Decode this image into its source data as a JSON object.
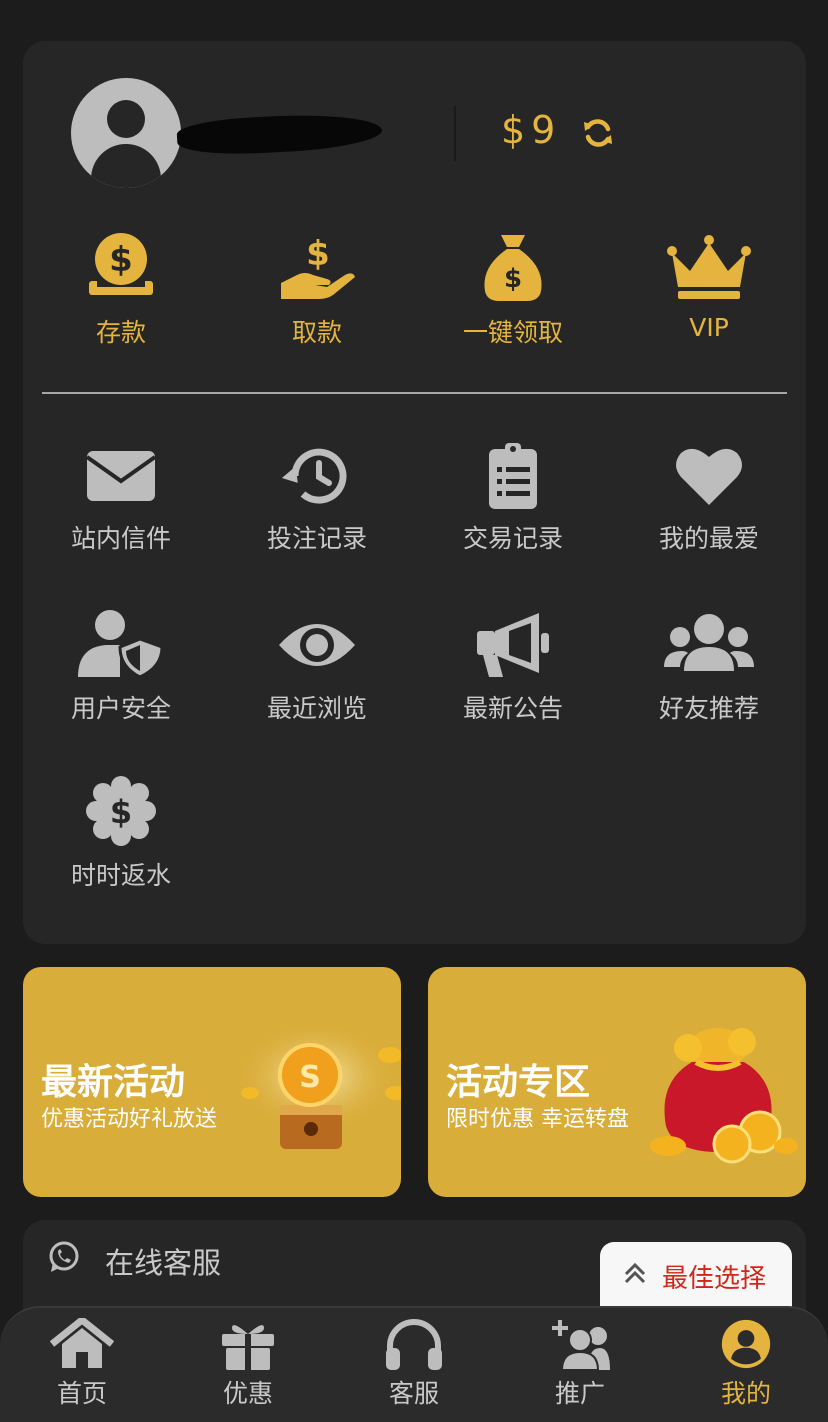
{
  "colors": {
    "accent": "#e4b43e",
    "card": "#262626",
    "background": "#1c1c1c",
    "icon_gray": "#bdbdbd",
    "best_red": "#d0261c"
  },
  "profile": {
    "balance": "$9",
    "avatar_icon": "user-avatar-icon",
    "refresh_icon": "refresh-icon"
  },
  "quick_actions": [
    {
      "label": "存款",
      "icon": "deposit-coin-icon"
    },
    {
      "label": "取款",
      "icon": "withdraw-hand-icon"
    },
    {
      "label": "一键领取",
      "icon": "money-bag-icon"
    },
    {
      "label": "VIP",
      "icon": "crown-icon"
    }
  ],
  "menu": [
    {
      "label": "站内信件",
      "icon": "mail-icon"
    },
    {
      "label": "投注记录",
      "icon": "history-icon"
    },
    {
      "label": "交易记录",
      "icon": "clipboard-icon"
    },
    {
      "label": "我的最爱",
      "icon": "heart-icon"
    },
    {
      "label": "用户安全",
      "icon": "user-shield-icon"
    },
    {
      "label": "最近浏览",
      "icon": "eye-icon"
    },
    {
      "label": "最新公告",
      "icon": "megaphone-icon"
    },
    {
      "label": "好友推荐",
      "icon": "users-icon"
    },
    {
      "label": "时时返水",
      "icon": "dollar-badge-icon"
    }
  ],
  "promos": [
    {
      "title": "最新活动",
      "subtitle": "优惠活动好礼放送"
    },
    {
      "title": "活动专区",
      "subtitle": "限时优惠 幸运转盘"
    }
  ],
  "support": {
    "label": "在线客服",
    "icon": "whatsapp-icon"
  },
  "best_choice": {
    "label": "最佳选择"
  },
  "tabs": [
    {
      "label": "首页",
      "icon": "home-icon"
    },
    {
      "label": "优惠",
      "icon": "gift-icon"
    },
    {
      "label": "客服",
      "icon": "headset-icon"
    },
    {
      "label": "推广",
      "icon": "add-user-icon"
    },
    {
      "label": "我的",
      "icon": "profile-icon",
      "active": true
    }
  ]
}
